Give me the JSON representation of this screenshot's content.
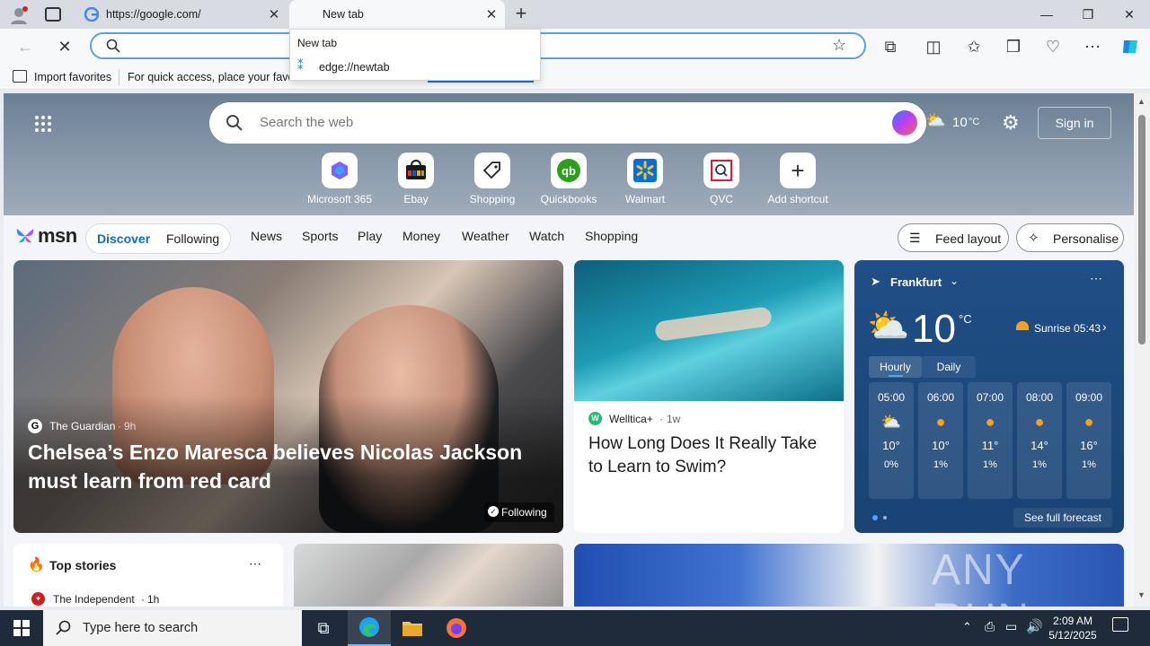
{
  "browser": {
    "tabs": [
      {
        "title": "https://google.com/"
      },
      {
        "title": "New tab"
      }
    ],
    "dropdown": {
      "header": "New tab",
      "item": "edge://newtab"
    },
    "favorites_bar": {
      "import_label": "Import favorites",
      "hint": "For quick access, place your favori"
    }
  },
  "msn": {
    "search_placeholder": "Search the web",
    "temperature_header": "10",
    "temperature_unit": "°C",
    "sign_in": "Sign in",
    "shortcuts": [
      {
        "label": "Microsoft 365"
      },
      {
        "label": "Ebay"
      },
      {
        "label": "Shopping"
      },
      {
        "label": "Quickbooks"
      },
      {
        "label": "Walmart"
      },
      {
        "label": "QVC"
      },
      {
        "label": "Add shortcut"
      }
    ],
    "logo": "msn",
    "nav": {
      "discover": "Discover",
      "following": "Following",
      "items": [
        "News",
        "Sports",
        "Play",
        "Money",
        "Weather",
        "Watch",
        "Shopping"
      ],
      "feed_layout": "Feed layout",
      "personalise": "Personalise"
    },
    "main_story": {
      "source": "The Guardian",
      "age": "9h",
      "headline": "Chelsea’s Enzo Maresca believes Nicolas Jackson must learn from red card",
      "following_label": "Following"
    },
    "side_story": {
      "source": "Welltica+",
      "age": "1w",
      "headline": "How Long Does It Really Take to Learn to Swim?"
    },
    "weather": {
      "location": "Frankfurt",
      "temp": "10",
      "unit": "°C",
      "sunrise": "Sunrise 05:43",
      "tab_hourly": "Hourly",
      "tab_daily": "Daily",
      "hours": [
        {
          "time": "05:00",
          "temp": "10°",
          "precip": "0%"
        },
        {
          "time": "06:00",
          "temp": "10°",
          "precip": "1%"
        },
        {
          "time": "07:00",
          "temp": "11°",
          "precip": "1%"
        },
        {
          "time": "08:00",
          "temp": "14°",
          "precip": "1%"
        },
        {
          "time": "09:00",
          "temp": "16°",
          "precip": "1%"
        }
      ],
      "see_forecast": "See full forecast"
    },
    "top_stories": {
      "title": "Top stories",
      "first_source": "The Independent",
      "first_age": "1h"
    }
  },
  "taskbar": {
    "search_placeholder": "Type here to search",
    "time": "2:09 AM",
    "date": "5/12/2025"
  },
  "watermark": "ANY RUN"
}
